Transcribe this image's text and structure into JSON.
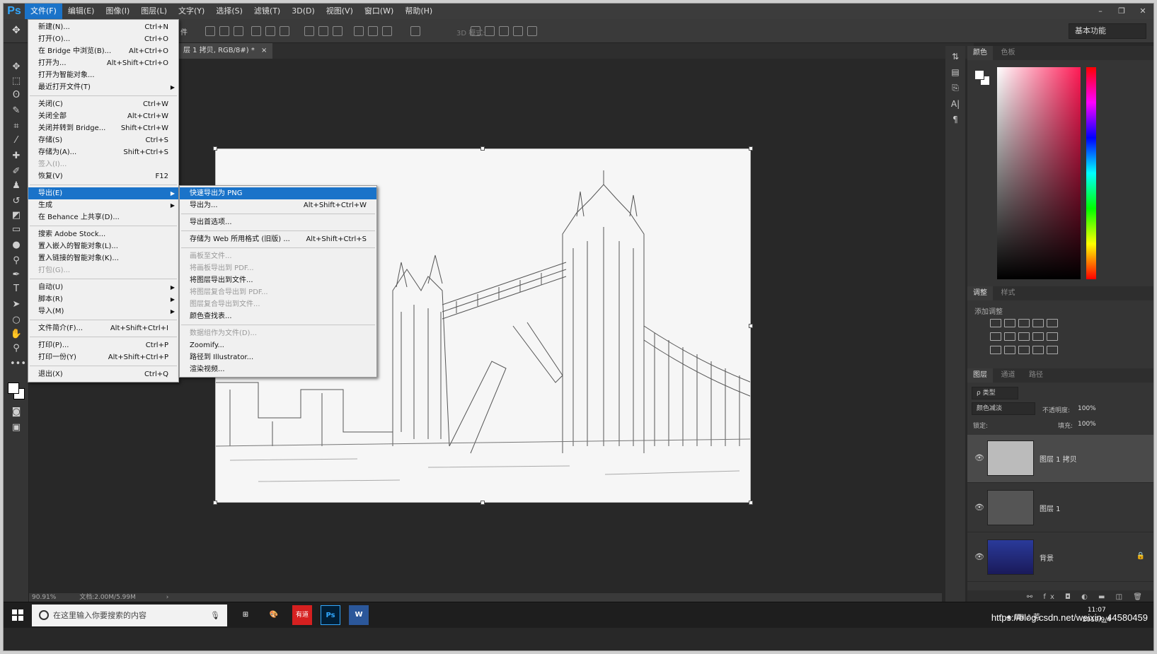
{
  "app": {
    "logo": "Ps"
  },
  "menubar": [
    "文件(F)",
    "编辑(E)",
    "图像(I)",
    "图层(L)",
    "文字(Y)",
    "选择(S)",
    "滤镜(T)",
    "3D(D)",
    "视图(V)",
    "窗口(W)",
    "帮助(H)"
  ],
  "window_controls": [
    "–",
    "❐",
    "✕"
  ],
  "options_bar": {
    "mode_3d": "3D 模式:",
    "workspace": "基本功能",
    "frag": "件"
  },
  "document_tab": {
    "label": "层 1 拷贝, RGB/8#) *",
    "close": "×"
  },
  "file_menu": [
    {
      "label": "新建(N)...",
      "shortcut": "Ctrl+N"
    },
    {
      "label": "打开(O)...",
      "shortcut": "Ctrl+O"
    },
    {
      "label": "在 Bridge 中浏览(B)...",
      "shortcut": "Alt+Ctrl+O"
    },
    {
      "label": "打开为...",
      "shortcut": "Alt+Shift+Ctrl+O"
    },
    {
      "label": "打开为智能对象...",
      "shortcut": ""
    },
    {
      "label": "最近打开文件(T)",
      "shortcut": "",
      "arrow": true
    },
    {
      "sep": true
    },
    {
      "label": "关闭(C)",
      "shortcut": "Ctrl+W"
    },
    {
      "label": "关闭全部",
      "shortcut": "Alt+Ctrl+W"
    },
    {
      "label": "关闭并转到 Bridge...",
      "shortcut": "Shift+Ctrl+W"
    },
    {
      "label": "存储(S)",
      "shortcut": "Ctrl+S"
    },
    {
      "label": "存储为(A)...",
      "shortcut": "Shift+Ctrl+S"
    },
    {
      "label": "签入(I)...",
      "shortcut": "",
      "disabled": true
    },
    {
      "label": "恢复(V)",
      "shortcut": "F12"
    },
    {
      "sep": true
    },
    {
      "label": "导出(E)",
      "shortcut": "",
      "arrow": true,
      "highlight": true
    },
    {
      "label": "生成",
      "shortcut": "",
      "arrow": true
    },
    {
      "label": "在 Behance 上共享(D)...",
      "shortcut": ""
    },
    {
      "sep": true
    },
    {
      "label": "搜索 Adobe Stock...",
      "shortcut": ""
    },
    {
      "label": "置入嵌入的智能对象(L)...",
      "shortcut": ""
    },
    {
      "label": "置入链接的智能对象(K)...",
      "shortcut": ""
    },
    {
      "label": "打包(G)...",
      "shortcut": "",
      "disabled": true
    },
    {
      "sep": true
    },
    {
      "label": "自动(U)",
      "shortcut": "",
      "arrow": true
    },
    {
      "label": "脚本(R)",
      "shortcut": "",
      "arrow": true
    },
    {
      "label": "导入(M)",
      "shortcut": "",
      "arrow": true
    },
    {
      "sep": true
    },
    {
      "label": "文件简介(F)...",
      "shortcut": "Alt+Shift+Ctrl+I"
    },
    {
      "sep": true
    },
    {
      "label": "打印(P)...",
      "shortcut": "Ctrl+P"
    },
    {
      "label": "打印一份(Y)",
      "shortcut": "Alt+Shift+Ctrl+P"
    },
    {
      "sep": true
    },
    {
      "label": "退出(X)",
      "shortcut": "Ctrl+Q"
    }
  ],
  "export_submenu": [
    {
      "label": "快速导出为 PNG",
      "shortcut": "",
      "highlight": true
    },
    {
      "label": "导出为...",
      "shortcut": "Alt+Shift+Ctrl+W"
    },
    {
      "sep": true
    },
    {
      "label": "导出首选项...",
      "shortcut": ""
    },
    {
      "sep": true
    },
    {
      "label": "存储为 Web 所用格式 (旧版) ...",
      "shortcut": "Alt+Shift+Ctrl+S"
    },
    {
      "sep": true
    },
    {
      "label": "画板至文件...",
      "shortcut": "",
      "disabled": true
    },
    {
      "label": "将画板导出到 PDF...",
      "shortcut": "",
      "disabled": true
    },
    {
      "label": "将图层导出到文件...",
      "shortcut": ""
    },
    {
      "label": "将图层复合导出到 PDF...",
      "shortcut": "",
      "disabled": true
    },
    {
      "label": "图层复合导出到文件...",
      "shortcut": "",
      "disabled": true
    },
    {
      "label": "颜色查找表...",
      "shortcut": ""
    },
    {
      "sep": true
    },
    {
      "label": "数据组作为文件(D)...",
      "shortcut": "",
      "disabled": true
    },
    {
      "label": "Zoomify...",
      "shortcut": ""
    },
    {
      "label": "路径到 Illustrator...",
      "shortcut": ""
    },
    {
      "label": "渲染视频...",
      "shortcut": ""
    }
  ],
  "status_bar": {
    "zoom": "90.91%",
    "doc_info": "文档:2.00M/5.99M",
    "arrow": "›"
  },
  "color_panel": {
    "tabs": [
      "颜色",
      "色板"
    ]
  },
  "adjust_panel": {
    "tabs": [
      "调整",
      "样式"
    ],
    "label": "添加调整"
  },
  "layers_panel": {
    "tabs": [
      "图层",
      "通道",
      "路径"
    ],
    "filter": "ρ 类型",
    "blend_mode": "颜色减淡",
    "opacity_label": "不透明度:",
    "opacity": "100%",
    "lock_label": "锁定:",
    "fill_label": "填充:",
    "fill": "100%",
    "layers": [
      {
        "name": "图层 1 拷贝",
        "selected": true,
        "locked": false
      },
      {
        "name": "图层 1",
        "selected": false,
        "locked": false
      },
      {
        "name": "背景",
        "selected": false,
        "locked": true
      }
    ],
    "bottom_icons": "⚯ fx ◘ ◐ ▬ ◫ 🗑"
  },
  "taskbar": {
    "search_placeholder": "在这里输入你要搜索的内容",
    "time": "11:07",
    "date": "2019/9/4",
    "app_icons": [
      "⊞",
      "🎨",
      "有道",
      "Ps",
      "W"
    ]
  },
  "watermark": "https://blog.csdn.net/weixin_44580459",
  "colors": {
    "accent": "#1a73c9",
    "ps_blue": "#31a8ff",
    "panel": "#353535",
    "canvas": "#282828"
  }
}
